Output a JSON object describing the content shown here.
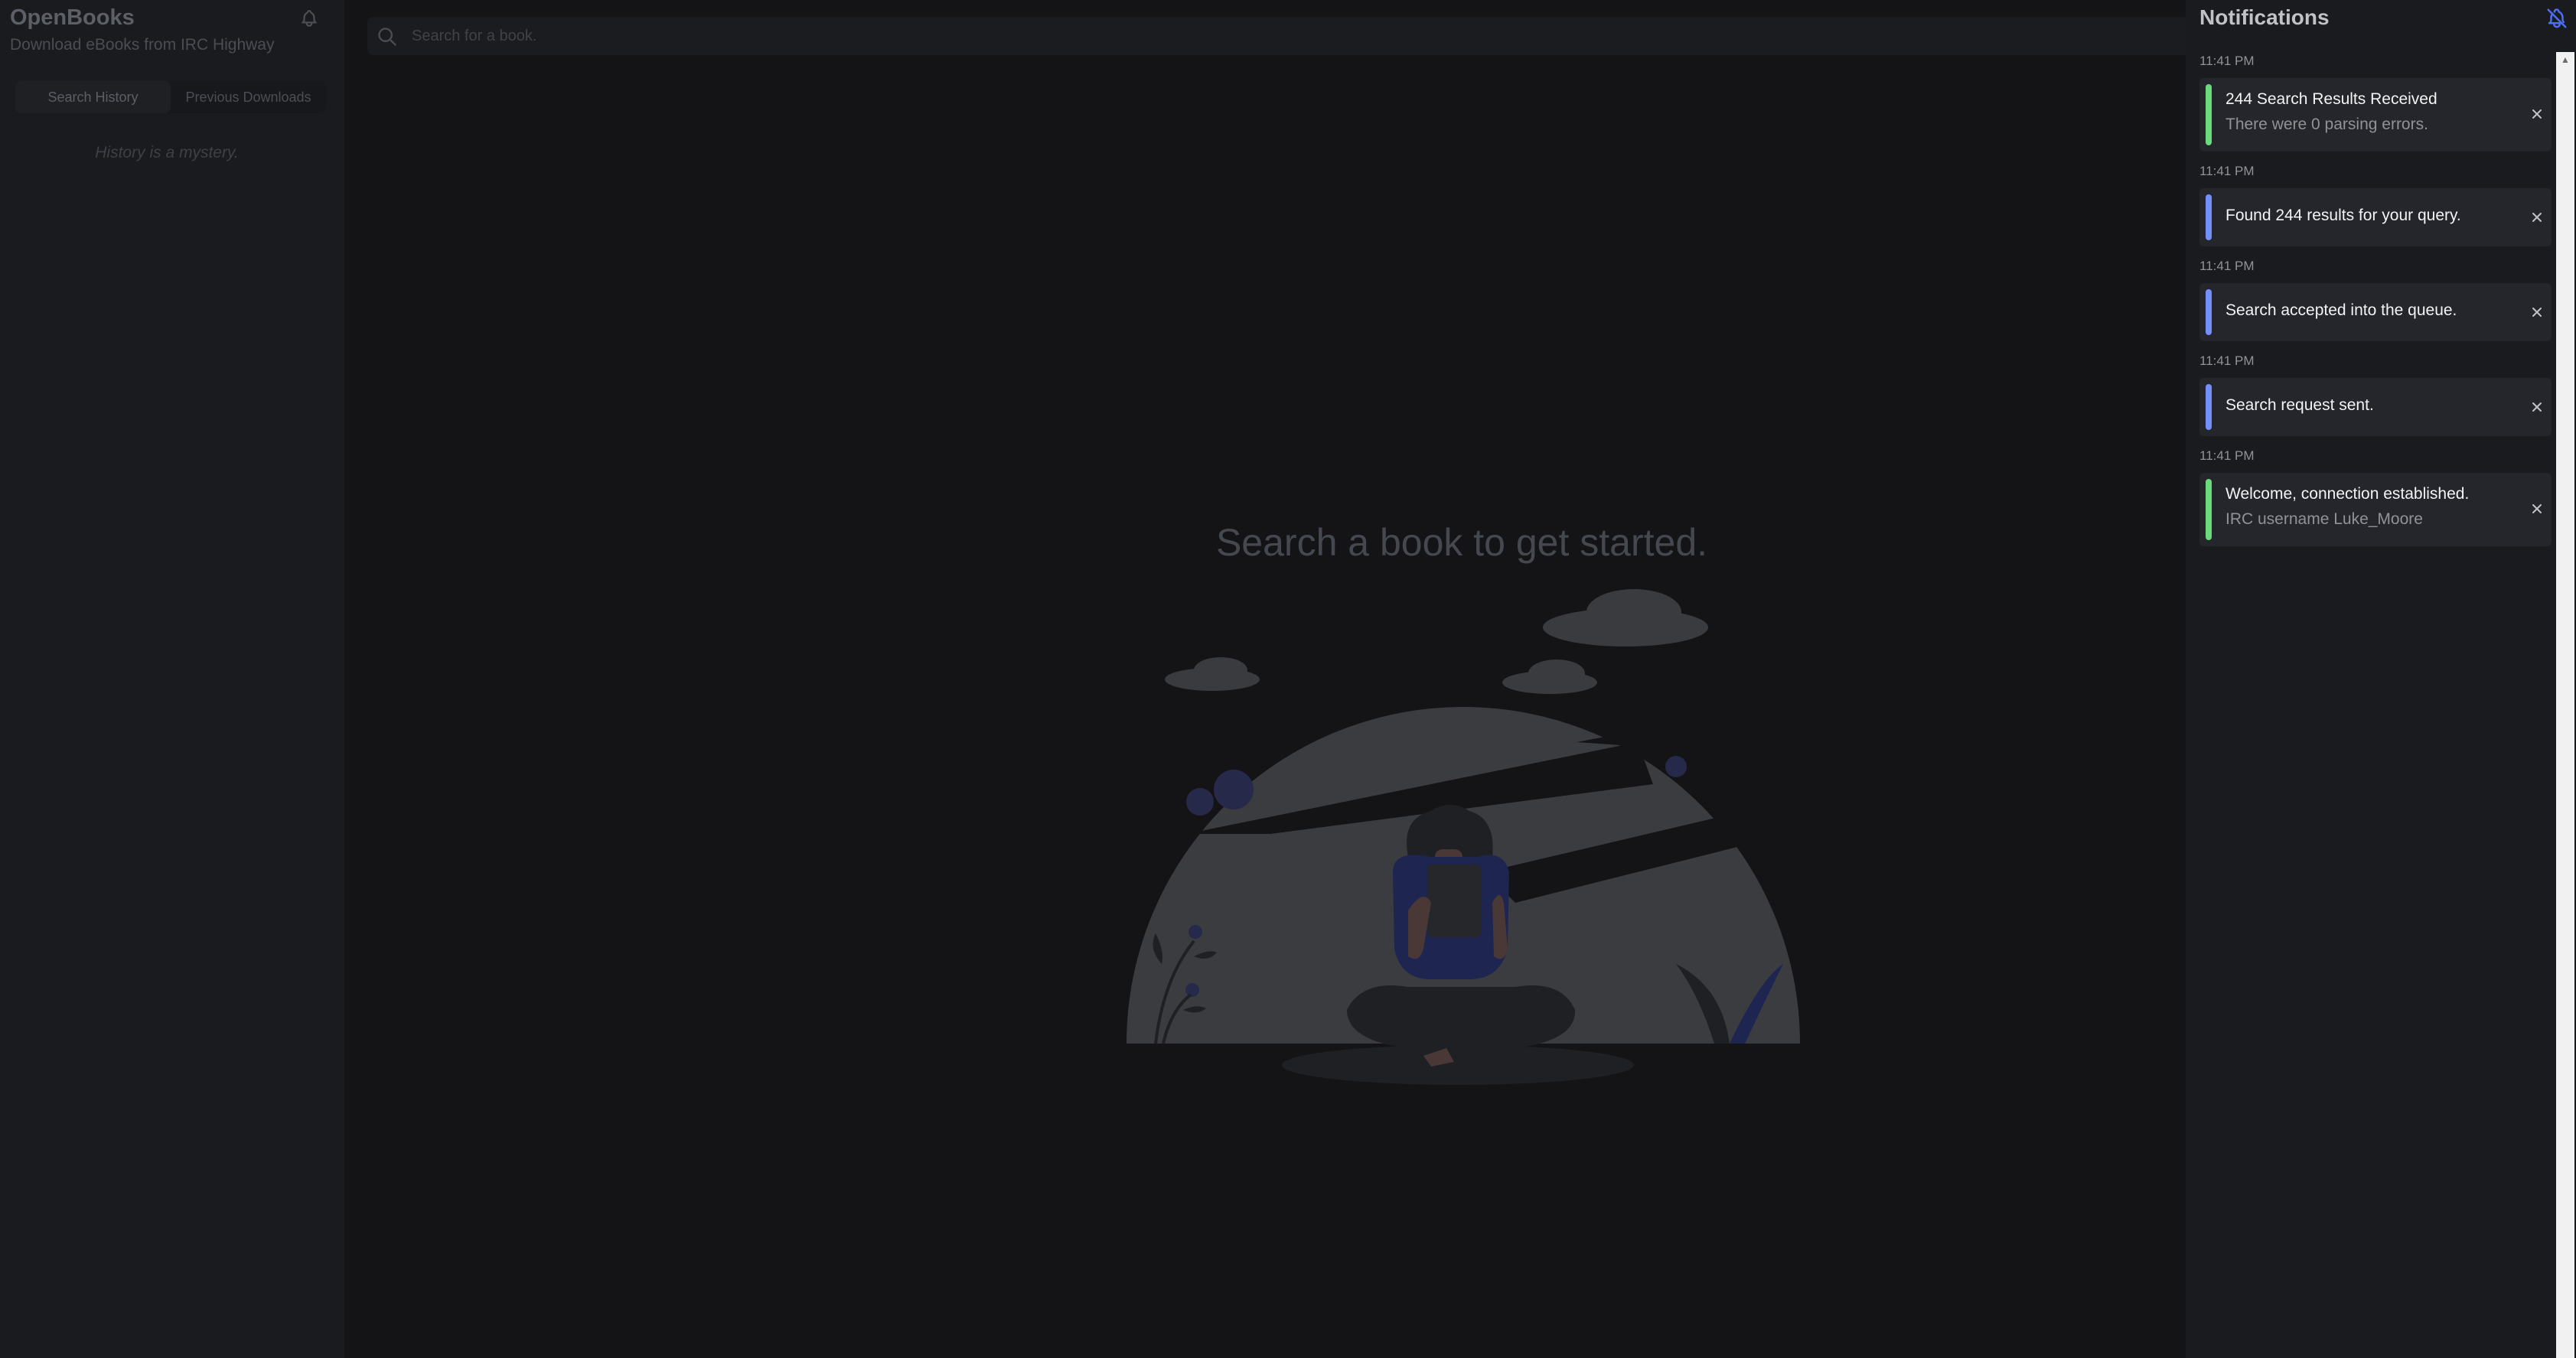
{
  "app": {
    "title": "OpenBooks",
    "subtitle": "Download eBooks from IRC Highway"
  },
  "sidebar": {
    "tabs": [
      {
        "label": "Search History",
        "active": true
      },
      {
        "label": "Previous Downloads",
        "active": false
      }
    ],
    "empty_message": "History is a mystery."
  },
  "search": {
    "placeholder": "Search for a book."
  },
  "main": {
    "empty_title": "Search a book to get started."
  },
  "notifications": {
    "title": "Notifications",
    "items": [
      {
        "time": "11:41 PM",
        "title": "244 Search Results Received",
        "message": "There were 0 parsing errors.",
        "status": "success",
        "color": "#69db7c"
      },
      {
        "time": "11:41 PM",
        "title": "Found 244 results for your query.",
        "message": "",
        "status": "info",
        "color": "#748ffc"
      },
      {
        "time": "11:41 PM",
        "title": "Search accepted into the queue.",
        "message": "",
        "status": "info",
        "color": "#748ffc"
      },
      {
        "time": "11:41 PM",
        "title": "Search request sent.",
        "message": "",
        "status": "info",
        "color": "#748ffc"
      },
      {
        "time": "11:41 PM",
        "title": "Welcome, connection established.",
        "message": "IRC username Luke_Moore",
        "status": "success",
        "color": "#69db7c"
      }
    ]
  },
  "colors": {
    "background": "#141417",
    "panel": "#1a1b1e",
    "card": "#25262b",
    "success": "#69db7c",
    "info": "#748ffc",
    "bell_off_icon": "#4c6ef5"
  },
  "icons": [
    "bell-icon",
    "search-icon",
    "bell-off-icon",
    "close-icon"
  ]
}
